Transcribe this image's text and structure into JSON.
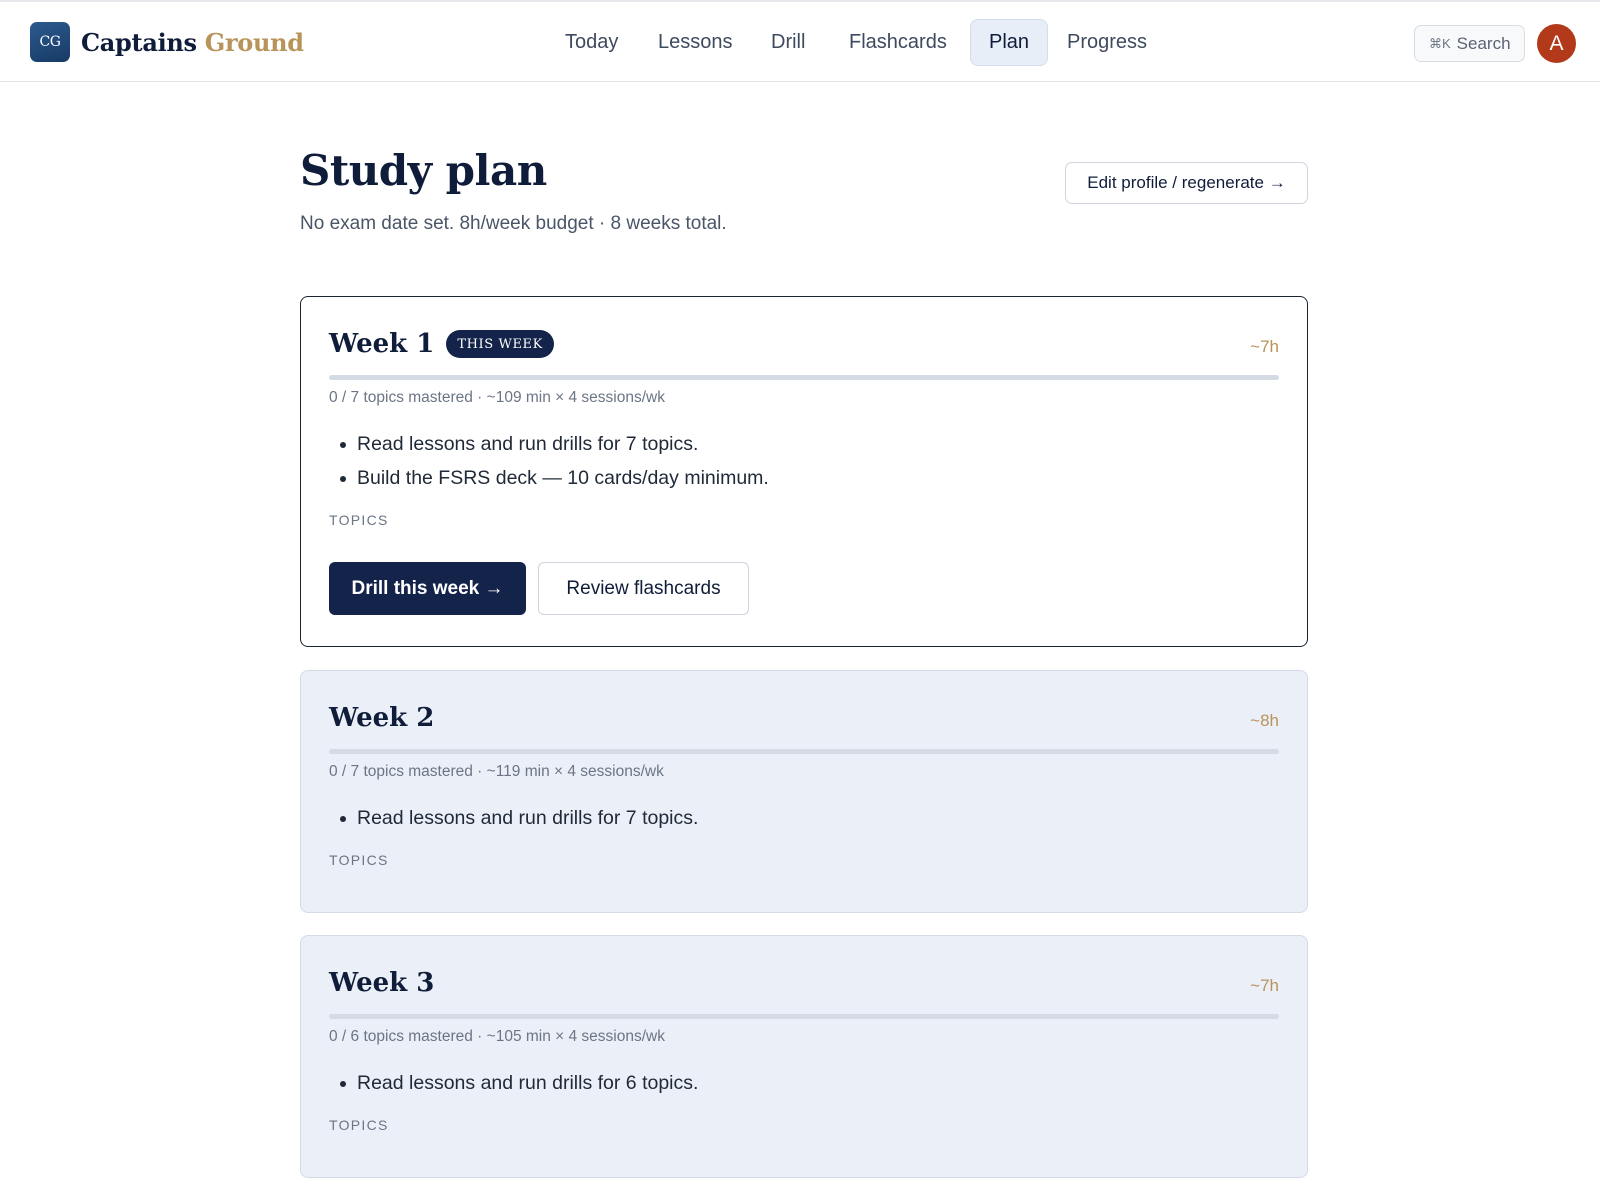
{
  "brand": {
    "logo_text": "CG",
    "name_part1": "Captains",
    "name_part2": "Ground"
  },
  "nav": {
    "items": [
      "Today",
      "Lessons",
      "Drill",
      "Flashcards",
      "Plan",
      "Progress"
    ],
    "active": "Plan"
  },
  "search": {
    "shortcut": "⌘K",
    "label": "Search"
  },
  "user": {
    "avatar_initial": "A"
  },
  "page": {
    "title": "Study plan",
    "subtitle": "No exam date set. 8h/week budget · 8 weeks total.",
    "edit_button": "Edit profile / regenerate →"
  },
  "weeks": [
    {
      "title": "Week 1",
      "badge": "THIS WEEK",
      "hours": "~7h",
      "progress": 0,
      "meta": "0 / 7 topics mastered · ~109 min × 4 sessions/wk",
      "tasks": [
        "Read lessons and run drills for 7 topics.",
        "Build the FSRS deck — 10 cards/day minimum."
      ],
      "topics_label": "TOPICS",
      "primary_action": "Drill this week →",
      "secondary_action": "Review flashcards"
    },
    {
      "title": "Week 2",
      "hours": "~8h",
      "progress": 0,
      "meta": "0 / 7 topics mastered · ~119 min × 4 sessions/wk",
      "tasks": [
        "Read lessons and run drills for 7 topics."
      ],
      "topics_label": "TOPICS"
    },
    {
      "title": "Week 3",
      "hours": "~7h",
      "progress": 0,
      "meta": "0 / 6 topics mastered · ~105 min × 4 sessions/wk",
      "tasks": [
        "Read lessons and run drills for 6 topics."
      ],
      "topics_label": "TOPICS"
    }
  ],
  "colors": {
    "navy": "#14234a",
    "gold": "#b8935a",
    "card_bg": "#ebf0f8",
    "avatar": "#b23a1a"
  }
}
